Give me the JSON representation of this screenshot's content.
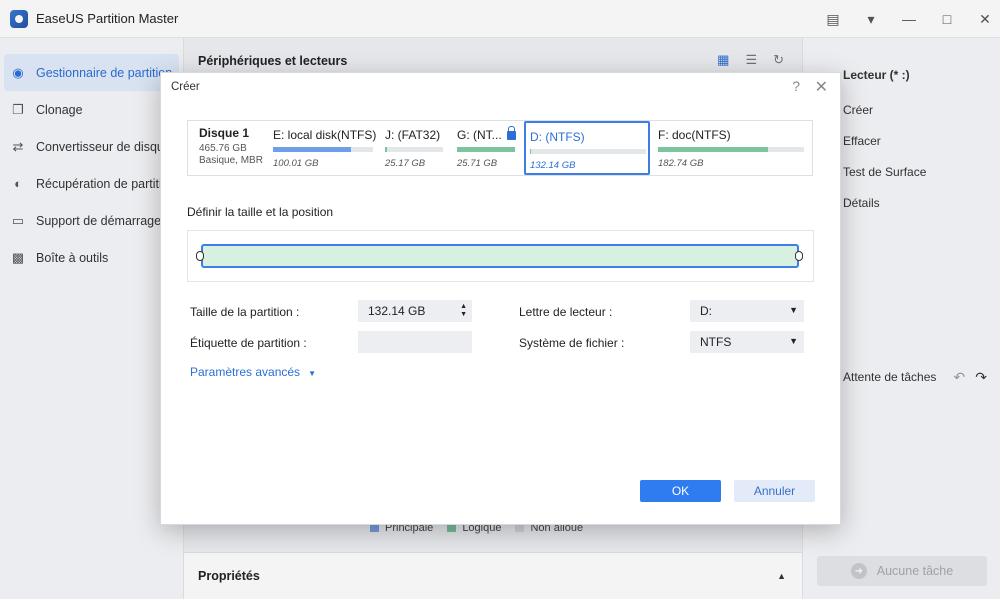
{
  "app": {
    "title": "EaseUS Partition Master"
  },
  "sidebar": {
    "items": [
      {
        "label": "Gestionnaire de partition",
        "icon": "disk-icon",
        "active": true
      },
      {
        "label": "Clonage",
        "icon": "clone-icon"
      },
      {
        "label": "Convertisseur de disque",
        "icon": "convert-icon"
      },
      {
        "label": "Récupération de partition",
        "icon": "recovery-icon"
      },
      {
        "label": "Support de démarrage",
        "icon": "boot-media-icon"
      },
      {
        "label": "Boîte à outils",
        "icon": "toolbox-icon"
      }
    ]
  },
  "main": {
    "header": "Périphériques et lecteurs",
    "legend": [
      {
        "label": "Principale",
        "color": "#7aa3e5"
      },
      {
        "label": "Logique",
        "color": "#7cc4a0"
      },
      {
        "label": "Non alloué",
        "color": "#d8dbe0"
      }
    ],
    "properties": "Propriétés"
  },
  "right_panel": {
    "items": [
      {
        "label": "Lecteur (* :)",
        "head": true
      },
      {
        "label": "Créer"
      },
      {
        "label": "Effacer"
      },
      {
        "label": "Test de Surface"
      },
      {
        "label": "Détails"
      }
    ],
    "pending": "Attente de tâches",
    "no_task": "Aucune tâche"
  },
  "dialog": {
    "title": "Créer",
    "disk": {
      "name": "Disque 1",
      "size": "465.76 GB",
      "type": "Basique, MBR"
    },
    "partitions": [
      {
        "name": "E: local disk(NTFS)",
        "size": "100.01 GB",
        "usage": 0.78,
        "color": "#6f9ee8"
      },
      {
        "name": "J: (FAT32)",
        "size": "25.17 GB",
        "usage": 0.03,
        "color": "#7cc4a0"
      },
      {
        "name": "G: (NT...",
        "size": "25.71 GB",
        "usage": 1.0,
        "color": "#7cc4a0",
        "locked": true
      },
      {
        "name": "D: (NTFS)",
        "size": "132.14 GB",
        "usage": 0.01,
        "color": "#7cc4a0",
        "selected": true
      },
      {
        "name": "F: doc(NTFS)",
        "size": "182.74 GB",
        "usage": 0.75,
        "color": "#7cc4a0"
      }
    ],
    "section_title": "Définir la taille et la position",
    "form": {
      "size_label": "Taille de la partition :",
      "size_value": "132.14 GB",
      "label_label": "Étiquette de partition :",
      "label_value": "",
      "drive_letter_label": "Lettre de lecteur :",
      "drive_letter_value": "D:",
      "fs_label": "Système de fichier :",
      "fs_value": "NTFS"
    },
    "advanced": "Paramètres avancés",
    "ok": "OK",
    "cancel": "Annuler"
  }
}
